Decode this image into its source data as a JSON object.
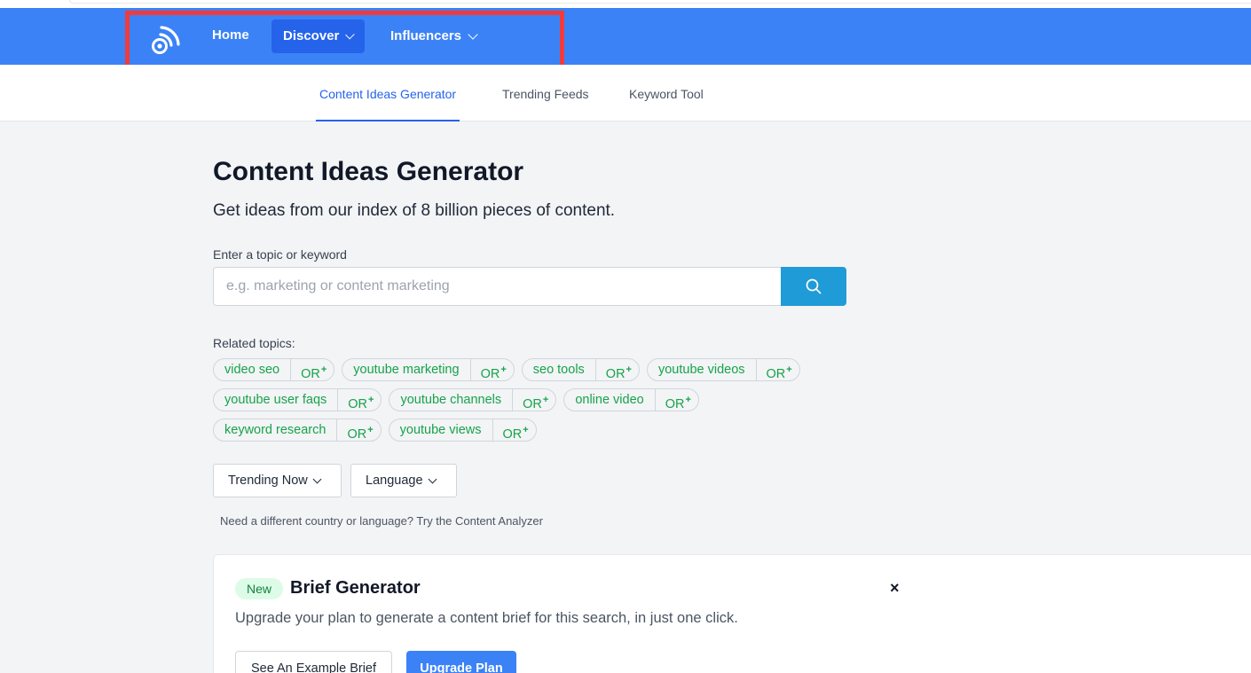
{
  "nav": {
    "home": "Home",
    "discover": "Discover",
    "influencers": "Influencers"
  },
  "subnav": {
    "content_ideas": "Content Ideas Generator",
    "trending_feeds": "Trending Feeds",
    "keyword_tool": "Keyword Tool"
  },
  "main": {
    "title": "Content Ideas Generator",
    "subtitle": "Get ideas from our index of 8 billion pieces of content.",
    "input_label": "Enter a topic or keyword",
    "search_placeholder": "e.g. marketing or content marketing",
    "related_label": "Related topics:",
    "or_label": "OR",
    "or_plus": "+",
    "topics": [
      "video seo",
      "youtube marketing",
      "seo tools",
      "youtube videos",
      "youtube user faqs",
      "youtube channels",
      "online video",
      "keyword research",
      "youtube views"
    ],
    "trending_now": "Trending Now",
    "language": "Language",
    "note": "Need a different country or language? Try the Content Analyzer"
  },
  "brief": {
    "badge": "New",
    "title": "Brief Generator",
    "close": "×",
    "text": "Upgrade your plan to generate a content brief for this search, in just one click.",
    "example_btn": "See An Example Brief",
    "upgrade_btn": "Upgrade Plan"
  },
  "colors": {
    "navbar": "#3b82f6",
    "active_nav": "#2563eb",
    "search_button": "#1f9bd7",
    "chip_text": "#16a34a",
    "highlight": "#ef3b3b"
  }
}
